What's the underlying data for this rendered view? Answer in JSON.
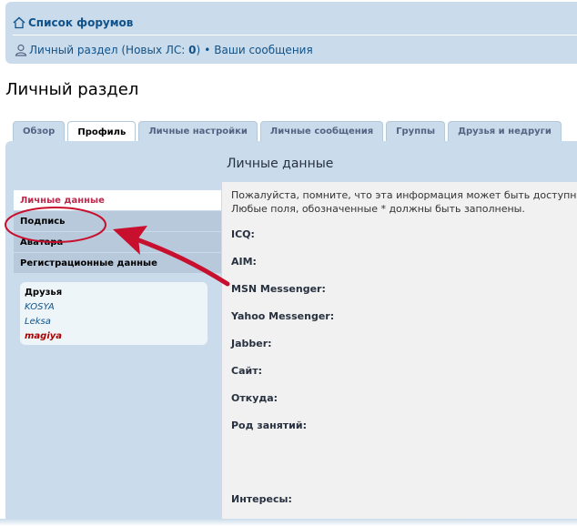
{
  "navbar": {
    "forum_list": "Список форумов",
    "ucp_label": "Личный раздел (Новых ЛС: ",
    "new_pm_count": "0",
    "ucp_close": ")",
    "bullet": "•",
    "your_posts": "Ваши сообщения"
  },
  "page_title": "Личный раздел",
  "tabs": [
    {
      "label": "Обзор"
    },
    {
      "label": "Профиль"
    },
    {
      "label": "Личные настройки"
    },
    {
      "label": "Личные сообщения"
    },
    {
      "label": "Группы"
    },
    {
      "label": "Друзья и недруги"
    }
  ],
  "section_title": "Личные данные",
  "menu": [
    {
      "label": "Личные данные"
    },
    {
      "label": "Подпись"
    },
    {
      "label": "Аватара"
    },
    {
      "label": "Регистрационные данные"
    }
  ],
  "friends": {
    "title": "Друзья",
    "list": [
      "KOSYA",
      "Leksa",
      "magiya"
    ]
  },
  "form": {
    "notice_line1": "Пожалуйста, помните, что эта информация может быть доступна",
    "notice_line2": "Любые поля, обозначенные * должны быть заполнены.",
    "fields": [
      "ICQ:",
      "AIM:",
      "MSN Messenger:",
      "Yahoo Messenger:",
      "Jabber:",
      "Сайт:",
      "Откуда:",
      "Род занятий:",
      "Интересы:"
    ]
  },
  "colors": {
    "panel_bg": "#cadceb",
    "link": "#105289",
    "active_menu_text": "#bc2a4d",
    "annotation_red": "#c8102e"
  },
  "icons": {
    "home": "home-icon",
    "user": "user-icon"
  }
}
